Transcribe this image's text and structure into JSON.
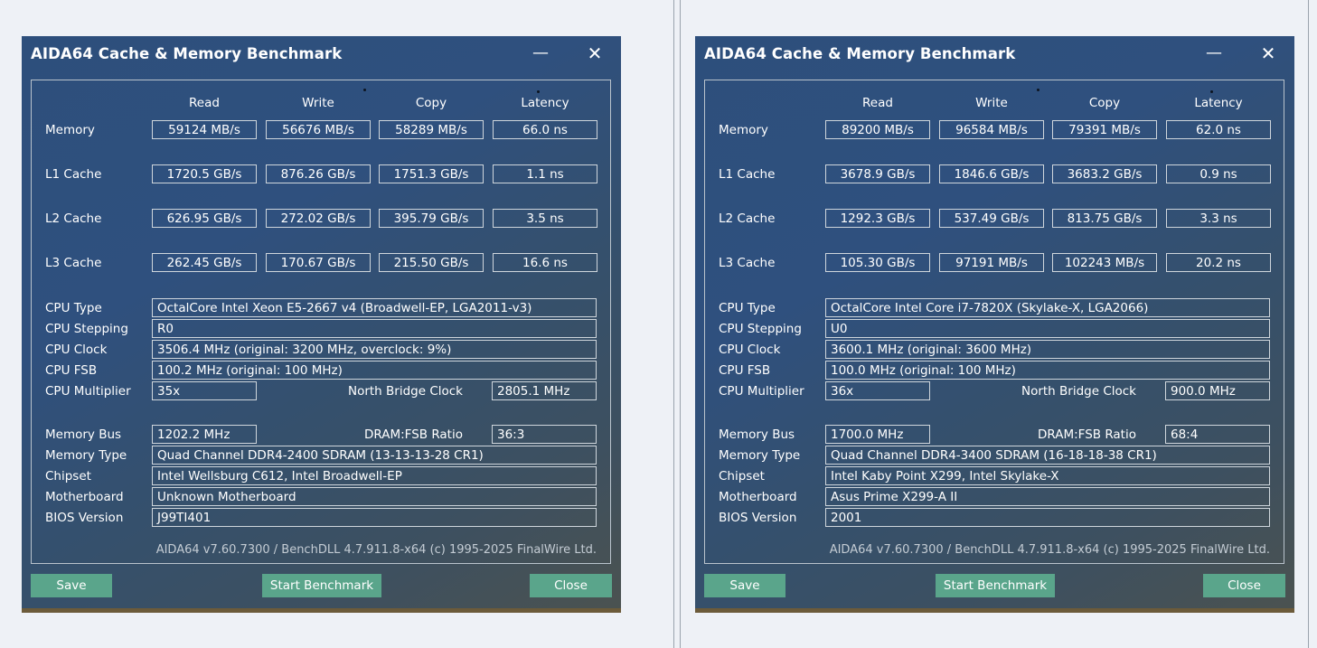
{
  "windows": [
    {
      "title": "AIDA64 Cache & Memory Benchmark",
      "columns": [
        "Read",
        "Write",
        "Copy",
        "Latency"
      ],
      "rows": [
        {
          "label": "Memory",
          "values": [
            "59124 MB/s",
            "56676 MB/s",
            "58289 MB/s",
            "66.0 ns"
          ]
        },
        {
          "label": "L1 Cache",
          "values": [
            "1720.5 GB/s",
            "876.26 GB/s",
            "1751.3 GB/s",
            "1.1 ns"
          ]
        },
        {
          "label": "L2 Cache",
          "values": [
            "626.95 GB/s",
            "272.02 GB/s",
            "395.79 GB/s",
            "3.5 ns"
          ]
        },
        {
          "label": "L3 Cache",
          "values": [
            "262.45 GB/s",
            "170.67 GB/s",
            "215.50 GB/s",
            "16.6 ns"
          ]
        }
      ],
      "cpu_type": {
        "label": "CPU Type",
        "value": "OctalCore Intel Xeon E5-2667 v4  (Broadwell-EP, LGA2011-v3)"
      },
      "cpu_stepping": {
        "label": "CPU Stepping",
        "value": "R0"
      },
      "cpu_clock": {
        "label": "CPU Clock",
        "value": "3506.4 MHz  (original: 3200 MHz, overclock: 9%)"
      },
      "cpu_fsb": {
        "label": "CPU FSB",
        "value": "100.2 MHz  (original: 100 MHz)"
      },
      "cpu_multiplier": {
        "label": "CPU Multiplier",
        "value": "35x"
      },
      "north_bridge_clock": {
        "label": "North Bridge Clock",
        "value": "2805.1 MHz"
      },
      "memory_bus": {
        "label": "Memory Bus",
        "value": "1202.2 MHz"
      },
      "dram_fsb_ratio": {
        "label": "DRAM:FSB Ratio",
        "value": "36:3"
      },
      "memory_type": {
        "label": "Memory Type",
        "value": "Quad Channel DDR4-2400 SDRAM  (13-13-13-28 CR1)"
      },
      "chipset": {
        "label": "Chipset",
        "value": "Intel Wellsburg C612, Intel Broadwell-EP"
      },
      "motherboard": {
        "label": "Motherboard",
        "value": "Unknown Motherboard"
      },
      "bios_version": {
        "label": "BIOS Version",
        "value": "J99TI401"
      },
      "footer": "AIDA64 v7.60.7300 / BenchDLL 4.7.911.8-x64  (c) 1995-2025 FinalWire Ltd.",
      "buttons": {
        "save": "Save",
        "start": "Start Benchmark",
        "close": "Close"
      },
      "icons": {
        "minimize": "minimize-icon",
        "close": "close-icon"
      }
    },
    {
      "title": "AIDA64 Cache & Memory Benchmark",
      "columns": [
        "Read",
        "Write",
        "Copy",
        "Latency"
      ],
      "rows": [
        {
          "label": "Memory",
          "values": [
            "89200 MB/s",
            "96584 MB/s",
            "79391 MB/s",
            "62.0 ns"
          ]
        },
        {
          "label": "L1 Cache",
          "values": [
            "3678.9 GB/s",
            "1846.6 GB/s",
            "3683.2 GB/s",
            "0.9 ns"
          ]
        },
        {
          "label": "L2 Cache",
          "values": [
            "1292.3 GB/s",
            "537.49 GB/s",
            "813.75 GB/s",
            "3.3 ns"
          ]
        },
        {
          "label": "L3 Cache",
          "values": [
            "105.30 GB/s",
            "97191 MB/s",
            "102243 MB/s",
            "20.2 ns"
          ]
        }
      ],
      "cpu_type": {
        "label": "CPU Type",
        "value": "OctalCore Intel Core i7-7820X  (Skylake-X, LGA2066)"
      },
      "cpu_stepping": {
        "label": "CPU Stepping",
        "value": "U0"
      },
      "cpu_clock": {
        "label": "CPU Clock",
        "value": "3600.1 MHz  (original: 3600 MHz)"
      },
      "cpu_fsb": {
        "label": "CPU FSB",
        "value": "100.0 MHz  (original: 100 MHz)"
      },
      "cpu_multiplier": {
        "label": "CPU Multiplier",
        "value": "36x"
      },
      "north_bridge_clock": {
        "label": "North Bridge Clock",
        "value": "900.0 MHz"
      },
      "memory_bus": {
        "label": "Memory Bus",
        "value": "1700.0 MHz"
      },
      "dram_fsb_ratio": {
        "label": "DRAM:FSB Ratio",
        "value": "68:4"
      },
      "memory_type": {
        "label": "Memory Type",
        "value": "Quad Channel DDR4-3400 SDRAM  (16-18-18-38 CR1)"
      },
      "chipset": {
        "label": "Chipset",
        "value": "Intel Kaby Point X299, Intel Skylake-X"
      },
      "motherboard": {
        "label": "Motherboard",
        "value": "Asus Prime X299-A II"
      },
      "bios_version": {
        "label": "BIOS Version",
        "value": "2001"
      },
      "footer": "AIDA64 v7.60.7300 / BenchDLL 4.7.911.8-x64  (c) 1995-2025 FinalWire Ltd.",
      "buttons": {
        "save": "Save",
        "start": "Start Benchmark",
        "close": "Close"
      },
      "icons": {
        "minimize": "minimize-icon",
        "close": "close-icon"
      }
    }
  ],
  "colors": {
    "window_bg": "#2f507e",
    "button_bg": "#5aa58b",
    "desktop_bg": "#eef1f6"
  }
}
